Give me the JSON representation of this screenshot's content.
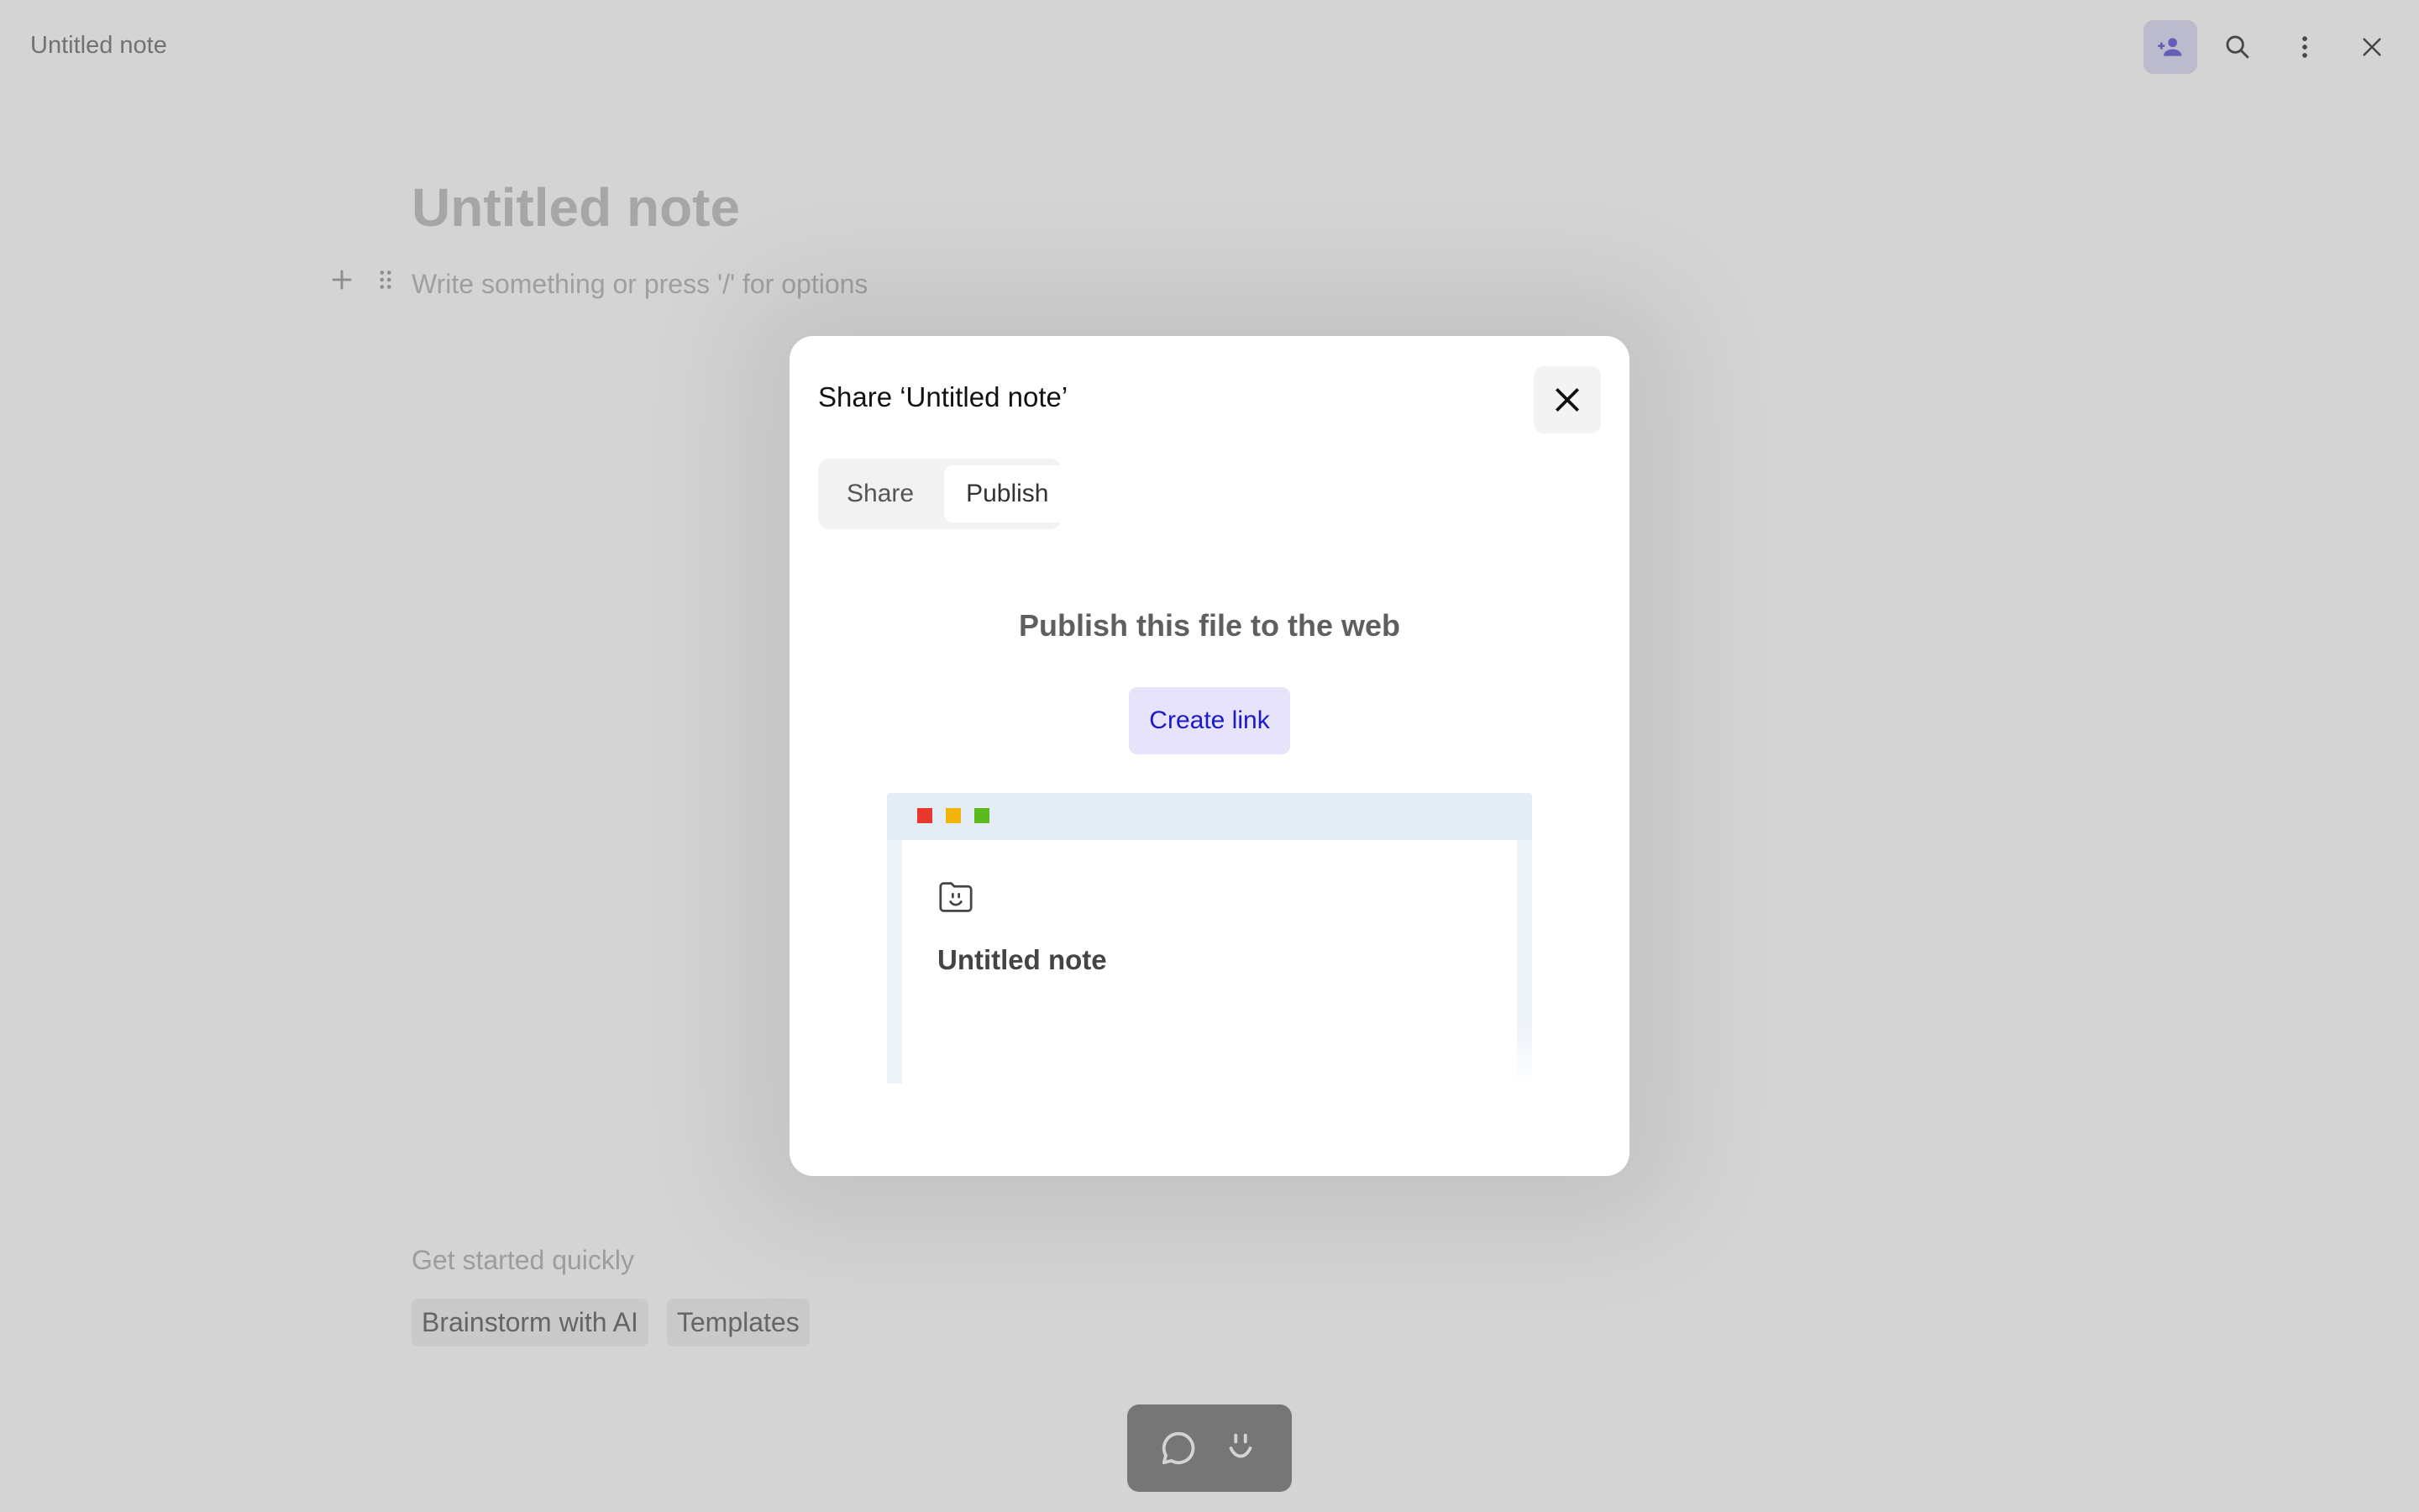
{
  "window": {
    "title": "Untitled note"
  },
  "toolbar": {
    "icons": [
      "add-person-icon",
      "search-icon",
      "more-vertical-icon",
      "close-icon"
    ],
    "accent": "#6b63d9"
  },
  "editor": {
    "title": "Untitled note",
    "placeholder": "Write something or press '/' for options"
  },
  "quick_start": {
    "heading": "Get started quickly",
    "chips": [
      "Brainstorm with AI",
      "Templates"
    ]
  },
  "dock": {
    "icons": [
      "comment-icon",
      "smile-icon"
    ]
  },
  "modal": {
    "title": "Share ‘Untitled note’",
    "tabs": [
      {
        "label": "Share",
        "active": false
      },
      {
        "label": "Publish",
        "active": true
      }
    ],
    "heading": "Publish this file to the web",
    "create_link_label": "Create link",
    "preview": {
      "title": "Untitled note",
      "dot_colors": [
        "#e8382e",
        "#f2b40a",
        "#5aba1e"
      ]
    }
  }
}
